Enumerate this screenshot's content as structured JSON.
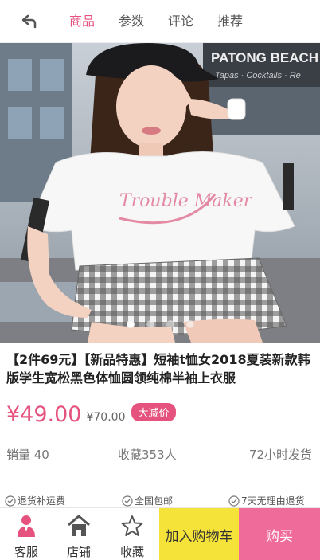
{
  "header": {
    "tabs": [
      {
        "label": "商品"
      },
      {
        "label": "参数"
      },
      {
        "label": "评论"
      },
      {
        "label": "推荐"
      }
    ],
    "active_tab": "商品"
  },
  "hero": {
    "sign_text": "PATONG BEACH",
    "sign_subtext": "Tapas · Cocktails · Re",
    "shirt_print": "Trouble Maker",
    "slides_count": 4,
    "active_slide": 1
  },
  "product": {
    "title": "【2件69元】【新品特惠】短袖t恤女2018夏装新款韩版学生宽松黑色体恤圆领纯棉半袖上衣服",
    "price": "¥49.00",
    "old_price": "¥70.00",
    "badge": "大减价",
    "sales": "销量 40",
    "favorites": "收藏353人",
    "shipping": "72小时发货"
  },
  "services": [
    {
      "label": "退货补运费"
    },
    {
      "label": "全国包邮"
    },
    {
      "label": "7天无理由退货"
    }
  ],
  "bottom_bar": {
    "service_label": "客服",
    "shop_label": "店铺",
    "favorite_label": "收藏",
    "cart_label": "加入购物车",
    "buy_label": "购买"
  },
  "colors": {
    "accent": "#e5527e",
    "cart_button": "#f5e33a",
    "buy_button": "#ef6c9a"
  }
}
